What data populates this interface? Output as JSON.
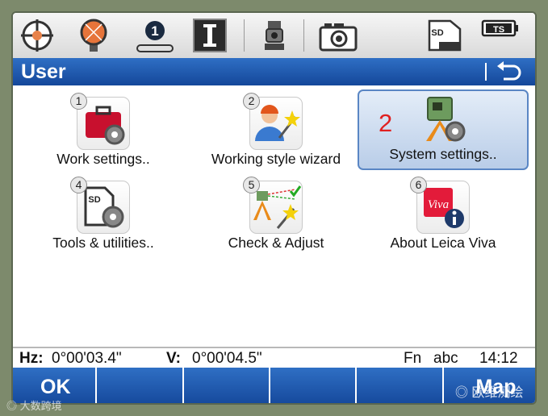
{
  "title": "User",
  "menu": {
    "items": [
      {
        "number": "1",
        "label": "Work settings.."
      },
      {
        "number": "2",
        "label": "Working style wizard"
      },
      {
        "number": "",
        "label": "System settings..",
        "marker": "2",
        "selected": true
      },
      {
        "number": "4",
        "label": "Tools & utilities.."
      },
      {
        "number": "5",
        "label": "Check & Adjust"
      },
      {
        "number": "6",
        "label": "About Leica Viva"
      }
    ]
  },
  "status_icons": {
    "job_number": "1",
    "memory_card": "SD",
    "ts_badge": "TS"
  },
  "icons": {
    "sd_label": "SD",
    "viva_label": "Viva"
  },
  "info": {
    "hz_label": "Hz:",
    "hz_value": "0°00'03.4\"",
    "v_label": "V:",
    "v_value": "0°00'04.5\"",
    "fn": "Fn",
    "input_mode": "abc",
    "time": "14:12"
  },
  "softkeys": {
    "f1": "OK",
    "f6": "Map"
  },
  "watermarks": {
    "left": "大数跨境",
    "right": "欧维测绘"
  },
  "colors": {
    "title_bar": "#1e57ad",
    "selected_tile": "#c8d8ee",
    "marker": "#e02020"
  }
}
